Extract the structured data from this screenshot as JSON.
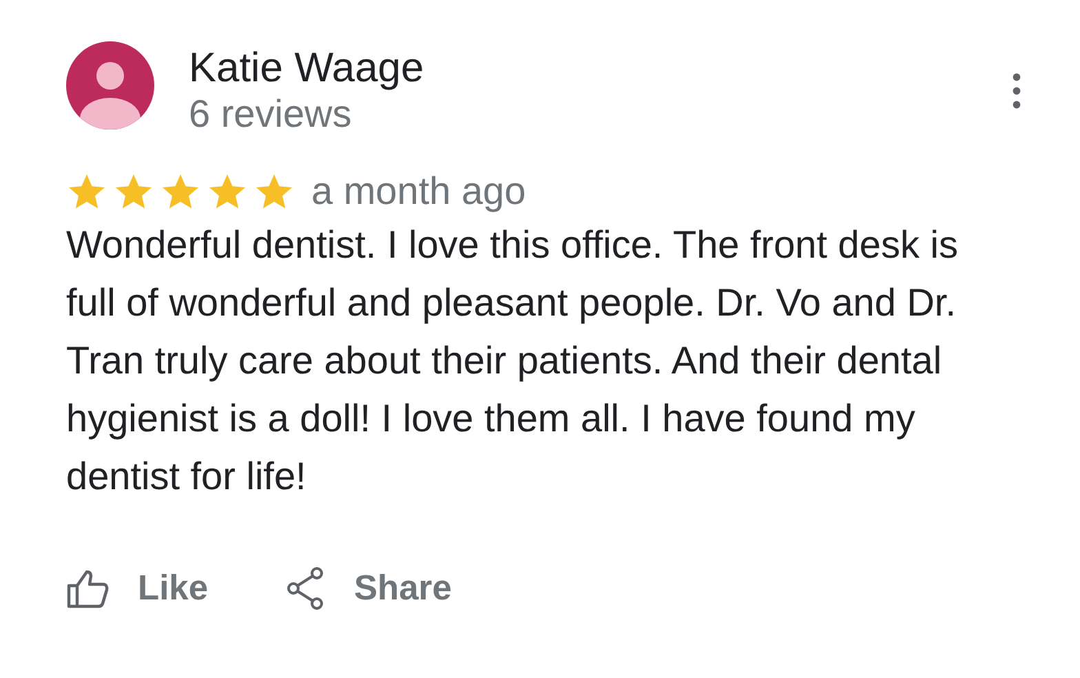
{
  "reviewer": {
    "name": "Katie Waage",
    "reviews": "6 reviews"
  },
  "review": {
    "stars": 5,
    "time": "a month ago",
    "text": "Wonderful dentist. I love this office. The front desk is full of wonderful and pleasant people. Dr. Vo and Dr. Tran truly care about their patients. And their dental hygienist is a doll! I love them all. I have found my dentist for life!"
  },
  "actions": [
    {
      "kind": "like",
      "label": "Like"
    },
    {
      "kind": "share",
      "label": "Share"
    }
  ]
}
